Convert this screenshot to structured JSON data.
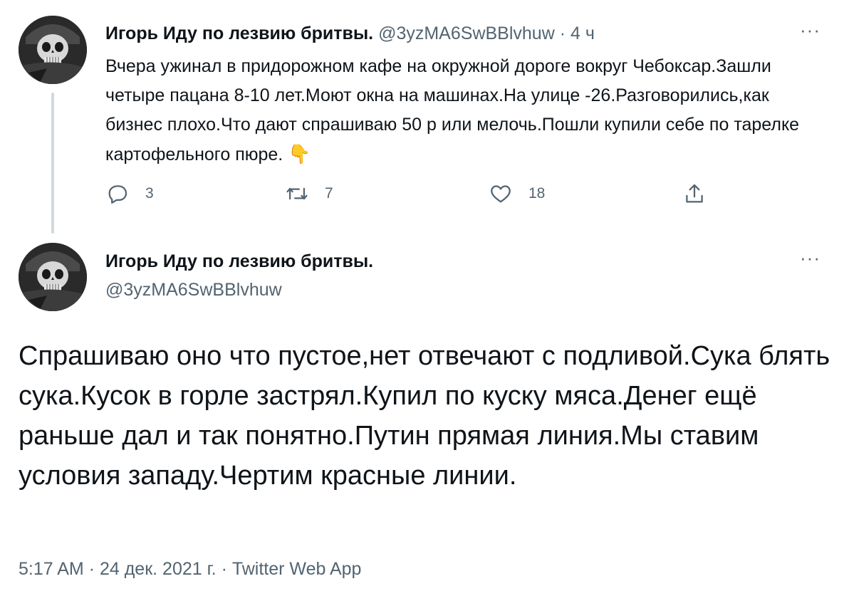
{
  "tweet1": {
    "author_name": "Игорь Иду по лезвию бритвы.",
    "handle": "@3yzMA6SwBBlvhuw",
    "separator": "·",
    "time": "4 ч",
    "more_label": "···",
    "text": "Вчера ужинал в придорожном кафе на окружной дороге вокруг Чебоксар.Зашли четыре пацана 8-10 лет.Моют окна на машинах.На улице -26.Разговорились,как бизнес плохо.Что дают спрашиваю 50 р или мелочь.Пошли купили себе по тарелке картофельного пюре.",
    "emoji": "👇",
    "reply_count": "3",
    "retweet_count": "7",
    "like_count": "18",
    "icons": {
      "reply": "reply-icon",
      "retweet": "retweet-icon",
      "like": "heart-icon",
      "share": "share-icon"
    }
  },
  "tweet2": {
    "author_name": "Игорь Иду по лезвию бритвы.",
    "handle": "@3yzMA6SwBBlvhuw",
    "more_label": "···",
    "text": "Спрашиваю оно что пустое,нет отвечают с подливой.Сука блять сука.Кусок в горле застрял.Купил по куску мяса.Денег ещё раньше дал и так понятно.Путин прямая линия.Мы ставим условия западу.Чертим красные линии.",
    "time": "5:17 AM",
    "date": "24 дек. 2021 г.",
    "source": "Twitter Web App",
    "separator": "·"
  },
  "colors": {
    "text": "#0f1419",
    "muted": "#536471",
    "thread_line": "#cfd9de"
  }
}
